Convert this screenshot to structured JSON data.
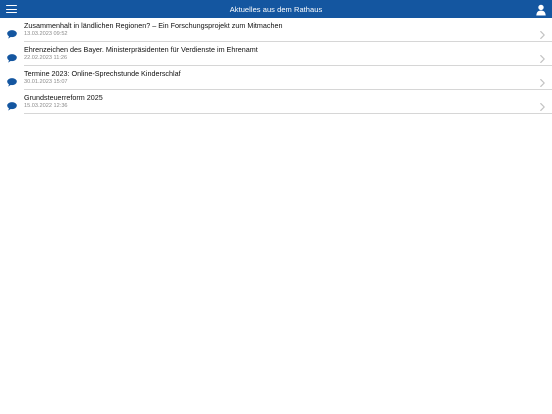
{
  "header": {
    "title": "Aktuelles aus dem Rathaus",
    "menu_icon": "hamburger-menu-icon",
    "profile_icon": "user-icon"
  },
  "colors": {
    "navbar": "#1456a0",
    "accent": "#1456a0",
    "separator": "#d6d6d6",
    "date_text": "#8a8a8a"
  },
  "news": [
    {
      "title": "Zusammenhalt in ländlichen Regionen? – Ein Forschungsprojekt zum Mitmachen",
      "date": "13.03.2023 09:52",
      "icon": "speech-bubble-icon"
    },
    {
      "title": "Ehrenzeichen des Bayer. Ministerpräsidenten für Verdienste im Ehrenamt",
      "date": "22.02.2023 11:26",
      "icon": "speech-bubble-icon"
    },
    {
      "title": "Termine 2023: Online-Sprechstunde Kinderschlaf",
      "date": "30.01.2023 15:07",
      "icon": "speech-bubble-icon"
    },
    {
      "title": "Grundsteuerreform 2025",
      "date": "15.03.2022 12:36",
      "icon": "speech-bubble-icon"
    }
  ]
}
